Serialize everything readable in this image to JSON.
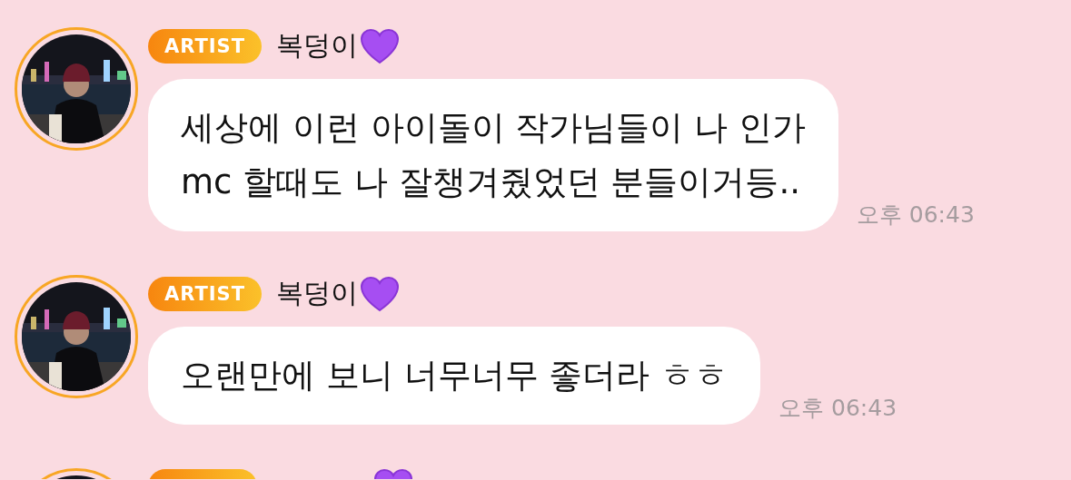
{
  "messages": [
    {
      "kind": "full",
      "badge": "ARTIST",
      "name": "복덩이",
      "lines": [
        "세상에 이런 아이돌이 작가님들이 나 인가",
        "mc 할때도 나 잘챙겨줬었던 분들이거등.."
      ],
      "time": "오후 06:43"
    },
    {
      "kind": "full",
      "badge": "ARTIST",
      "name": "복덩이",
      "lines": [
        "오랜만에 보니 너무너무 좋더라 ㅎㅎ"
      ],
      "time": "오후 06:43"
    },
    {
      "kind": "cut"
    }
  ]
}
